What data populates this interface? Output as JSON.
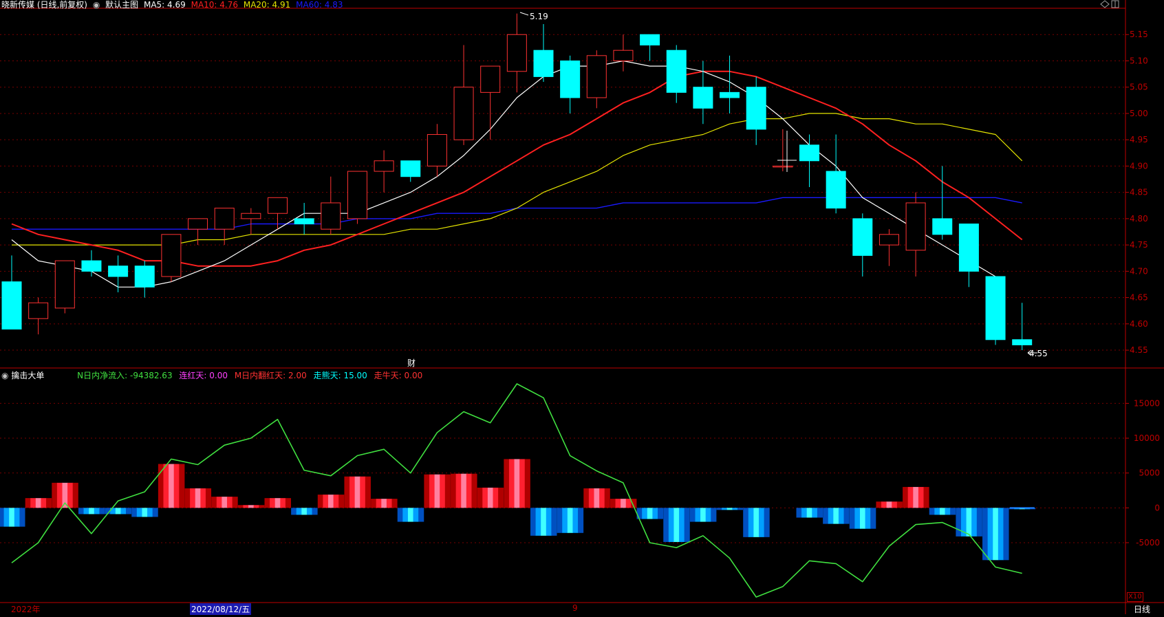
{
  "header": {
    "stock_title": "晓新传媒 (日线,前复权)",
    "view_label": "默认主图",
    "ma5_label": "MA5: 4.69",
    "ma10_label": "MA10: 4.76",
    "ma20_label": "MA20: 4.91",
    "ma60_label": "MA60: 4.83"
  },
  "indicator_header": {
    "name": "擒击大单",
    "net_inflow": "N日内净流入: -94382.63",
    "red_days": "连红天: 0.00",
    "m_red_days": "M日内翻红天: 2.00",
    "bear_days": "走熊天: 15.00",
    "bull_days": "走牛天: 0.00"
  },
  "annotations": {
    "high": "5.19",
    "low": "4.55",
    "finance_marker": "财"
  },
  "bottom_bar": {
    "year": "2022年",
    "cursor_date": "2022/08/12/五",
    "month": "9",
    "period": "日线",
    "zoom": "X10"
  },
  "colors": {
    "up": "#ff3232",
    "down": "#00ffff",
    "ma5": "#ffffff",
    "ma10": "#ff2020",
    "ma20": "#e6e600",
    "ma60": "#1a1aff",
    "net_line": "#40e040",
    "axis": "#c00000",
    "grid": "#7a0000"
  },
  "chart_data": [
    {
      "type": "candlestick",
      "ylim": [
        4.52,
        5.2
      ],
      "yticks": [
        4.55,
        4.6,
        4.65,
        4.7,
        4.75,
        4.8,
        4.85,
        4.9,
        4.95,
        5.0,
        5.05,
        5.1,
        5.15
      ],
      "ohlc": [
        [
          4.68,
          4.73,
          4.59,
          4.59
        ],
        [
          4.61,
          4.65,
          4.58,
          4.64
        ],
        [
          4.63,
          4.72,
          4.62,
          4.72
        ],
        [
          4.72,
          4.74,
          4.69,
          4.7
        ],
        [
          4.71,
          4.73,
          4.66,
          4.69
        ],
        [
          4.71,
          4.72,
          4.65,
          4.67
        ],
        [
          4.69,
          4.77,
          4.68,
          4.77
        ],
        [
          4.78,
          4.8,
          4.75,
          4.8
        ],
        [
          4.78,
          4.82,
          4.75,
          4.82
        ],
        [
          4.8,
          4.82,
          4.77,
          4.81
        ],
        [
          4.81,
          4.84,
          4.78,
          4.84
        ],
        [
          4.8,
          4.83,
          4.77,
          4.79
        ],
        [
          4.78,
          4.88,
          4.77,
          4.83
        ],
        [
          4.8,
          4.89,
          4.79,
          4.89
        ],
        [
          4.89,
          4.93,
          4.85,
          4.91
        ],
        [
          4.91,
          4.91,
          4.87,
          4.88
        ],
        [
          4.9,
          4.98,
          4.88,
          4.96
        ],
        [
          4.95,
          5.13,
          4.94,
          5.05
        ],
        [
          5.04,
          5.09,
          4.95,
          5.09
        ],
        [
          5.08,
          5.19,
          5.04,
          5.15
        ],
        [
          5.12,
          5.17,
          5.06,
          5.07
        ],
        [
          5.1,
          5.11,
          5.0,
          5.03
        ],
        [
          5.03,
          5.12,
          5.01,
          5.11
        ],
        [
          5.1,
          5.15,
          5.08,
          5.12
        ],
        [
          5.15,
          5.15,
          5.1,
          5.13
        ],
        [
          5.12,
          5.13,
          5.02,
          5.04
        ],
        [
          5.05,
          5.1,
          4.98,
          5.01
        ],
        [
          5.04,
          5.11,
          5.0,
          5.03
        ],
        [
          5.05,
          5.07,
          4.94,
          4.97
        ],
        [
          4.9,
          4.97,
          4.89,
          4.9
        ],
        [
          4.94,
          4.96,
          4.86,
          4.91
        ],
        [
          4.89,
          4.96,
          4.81,
          4.82
        ],
        [
          4.8,
          4.81,
          4.69,
          4.73
        ],
        [
          4.75,
          4.78,
          4.71,
          4.77
        ],
        [
          4.74,
          4.85,
          4.69,
          4.83
        ],
        [
          4.8,
          4.9,
          4.76,
          4.77
        ],
        [
          4.79,
          4.79,
          4.67,
          4.7
        ],
        [
          4.69,
          4.69,
          4.56,
          4.57
        ],
        [
          4.57,
          4.64,
          4.55,
          4.56
        ]
      ],
      "ma5": [
        4.76,
        4.72,
        4.71,
        4.7,
        4.67,
        4.67,
        4.68,
        4.7,
        4.72,
        4.75,
        4.78,
        4.81,
        4.81,
        4.81,
        4.83,
        4.85,
        4.88,
        4.92,
        4.97,
        5.03,
        5.07,
        5.09,
        5.09,
        5.1,
        5.09,
        5.09,
        5.08,
        5.06,
        5.03,
        4.99,
        4.94,
        4.9,
        4.84,
        4.81,
        4.78,
        4.75,
        4.72,
        4.69
      ],
      "ma10": [
        4.79,
        4.77,
        4.76,
        4.75,
        4.74,
        4.72,
        4.72,
        4.71,
        4.71,
        4.71,
        4.72,
        4.74,
        4.75,
        4.77,
        4.79,
        4.81,
        4.83,
        4.85,
        4.88,
        4.91,
        4.94,
        4.96,
        4.99,
        5.02,
        5.04,
        5.07,
        5.08,
        5.08,
        5.07,
        5.05,
        5.03,
        5.01,
        4.98,
        4.94,
        4.91,
        4.87,
        4.84,
        4.8,
        4.76
      ],
      "ma20": [
        4.75,
        4.75,
        4.75,
        4.75,
        4.75,
        4.75,
        4.75,
        4.76,
        4.76,
        4.77,
        4.77,
        4.77,
        4.77,
        4.77,
        4.77,
        4.78,
        4.78,
        4.79,
        4.8,
        4.82,
        4.85,
        4.87,
        4.89,
        4.92,
        4.94,
        4.95,
        4.96,
        4.98,
        4.99,
        4.99,
        5.0,
        5.0,
        4.99,
        4.99,
        4.98,
        4.98,
        4.97,
        4.96,
        4.91
      ],
      "ma60": [
        4.78,
        4.78,
        4.78,
        4.78,
        4.78,
        4.78,
        4.78,
        4.78,
        4.78,
        4.79,
        4.79,
        4.79,
        4.79,
        4.8,
        4.8,
        4.8,
        4.81,
        4.81,
        4.81,
        4.82,
        4.82,
        4.82,
        4.82,
        4.83,
        4.83,
        4.83,
        4.83,
        4.83,
        4.83,
        4.84,
        4.84,
        4.84,
        4.84,
        4.84,
        4.84,
        4.84,
        4.84,
        4.84,
        4.83
      ]
    },
    {
      "type": "bar",
      "ylim": [
        -13000,
        18000
      ],
      "yticks": [
        -5000,
        0,
        5000,
        10000,
        15000
      ],
      "values": [
        -2700,
        1400,
        3600,
        -900,
        -900,
        -1300,
        6300,
        2800,
        1600,
        400,
        1400,
        -1000,
        1900,
        4500,
        1300,
        -2000,
        4800,
        4900,
        2900,
        7000,
        -4000,
        -3600,
        2800,
        1300,
        -1600,
        -4900,
        -2000,
        -300,
        -4200,
        0,
        -1400,
        -2300,
        -3000,
        900,
        3000,
        -1000,
        -4100,
        -7500,
        -200
      ],
      "net_line": [
        -7900,
        -5000,
        700,
        -3700,
        1000,
        2300,
        7000,
        6200,
        9000,
        10000,
        12700,
        5400,
        4600,
        7500,
        8400,
        5000,
        10800,
        13800,
        12200,
        17800,
        15800,
        7500,
        5300,
        3600,
        -5000,
        -5700,
        -4000,
        -7200,
        -12800,
        -11300,
        -7600,
        -8000,
        -10600,
        -5500,
        -2400,
        -2100,
        -3800,
        -8500,
        -9400
      ]
    }
  ]
}
